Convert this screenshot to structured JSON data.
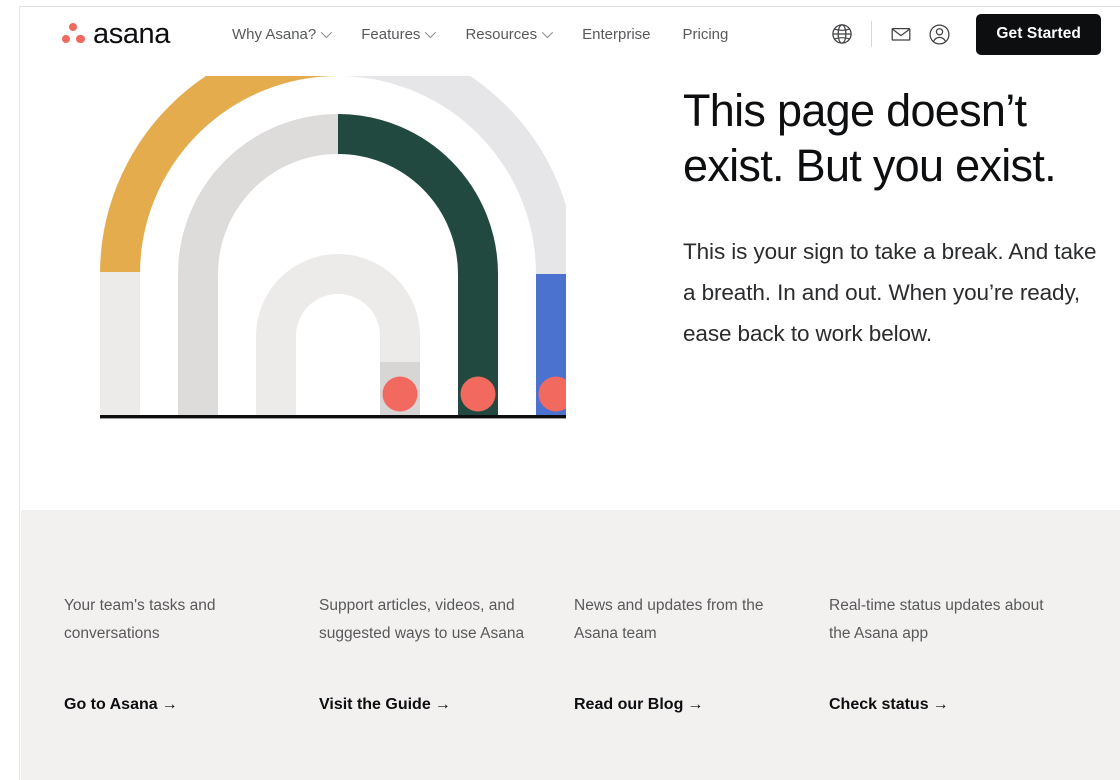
{
  "brand": {
    "name": "asana",
    "logo_icon": "asana-dots-logo",
    "dot_color": "#F06A60"
  },
  "nav": {
    "links": [
      {
        "label": "Why Asana?",
        "has_dropdown": true,
        "icon": "chevron-down-icon"
      },
      {
        "label": "Features",
        "has_dropdown": true,
        "icon": "chevron-down-icon"
      },
      {
        "label": "Resources",
        "has_dropdown": true,
        "icon": "chevron-down-icon"
      },
      {
        "label": "Enterprise",
        "has_dropdown": false,
        "icon": ""
      },
      {
        "label": "Pricing",
        "has_dropdown": false,
        "icon": ""
      }
    ],
    "icons": [
      {
        "name": "globe-icon",
        "label": "Language"
      },
      {
        "name": "mail-icon",
        "label": "Contact sales"
      },
      {
        "name": "person-icon",
        "label": "Log in"
      }
    ],
    "cta_label": "Get Started",
    "cta_bg": "#0d0e10"
  },
  "hero": {
    "headline": "This page doesn’t exist. But you exist.",
    "subcopy": "This is your sign to take a break. And take a breath. In and out. When you’re ready, ease back to work below.",
    "illustration": {
      "name": "concentric-arches-illustration",
      "colors": {
        "yellow": "#E5AC4D",
        "green": "#22493F",
        "blue": "#4A72CE",
        "light_gray": "#EDEBEA",
        "mid_gray": "#DEDCDB",
        "pale_gray": "#E6E5E8",
        "dot": "#F2695F",
        "baseline": "#0d0e10"
      }
    }
  },
  "footer": {
    "bg": "#F3F1F0",
    "columns": [
      {
        "description": "Your team's tasks and conversations",
        "link_label": "Go to Asana",
        "arrow": "→"
      },
      {
        "description": "Support articles, videos, and suggested ways to use Asana",
        "link_label": "Visit the Guide",
        "arrow": "→"
      },
      {
        "description": "News and updates from the Asana team",
        "link_label": "Read our Blog",
        "arrow": "→"
      },
      {
        "description": "Real-time status updates about the Asana app",
        "link_label": "Check status",
        "arrow": "→"
      }
    ]
  }
}
